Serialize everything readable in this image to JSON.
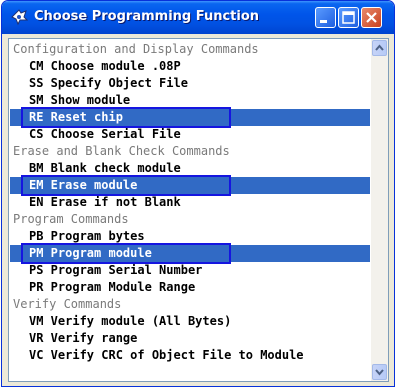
{
  "window": {
    "title": "Choose Programming Function"
  },
  "list": {
    "rows": [
      {
        "kind": "cat",
        "text": "Configuration and Display Commands",
        "selected": false
      },
      {
        "kind": "item",
        "text": "CM Choose module .08P",
        "selected": false
      },
      {
        "kind": "item",
        "text": "SS Specify Object File",
        "selected": false
      },
      {
        "kind": "item",
        "text": "SM Show module",
        "selected": false
      },
      {
        "kind": "item",
        "text": "RE Reset chip",
        "selected": true
      },
      {
        "kind": "item",
        "text": "CS Choose Serial File",
        "selected": false
      },
      {
        "kind": "cat",
        "text": "Erase and Blank Check Commands",
        "selected": false
      },
      {
        "kind": "item",
        "text": "BM Blank check module",
        "selected": false
      },
      {
        "kind": "item",
        "text": "EM Erase module",
        "selected": true
      },
      {
        "kind": "item",
        "text": "EN Erase if not Blank",
        "selected": false
      },
      {
        "kind": "cat",
        "text": "Program Commands",
        "selected": false
      },
      {
        "kind": "item",
        "text": "PB Program bytes",
        "selected": false
      },
      {
        "kind": "item",
        "text": "PM Program module",
        "selected": true
      },
      {
        "kind": "item",
        "text": "PS Program Serial Number",
        "selected": false
      },
      {
        "kind": "item",
        "text": "PR Program Module Range",
        "selected": false
      },
      {
        "kind": "cat",
        "text": "Verify Commands",
        "selected": false
      },
      {
        "kind": "item",
        "text": "VM Verify module (All Bytes)",
        "selected": false
      },
      {
        "kind": "item",
        "text": "VR Verify range",
        "selected": false
      },
      {
        "kind": "item",
        "text": "VC Verify CRC of Object File to Module",
        "selected": false
      }
    ]
  },
  "colors": {
    "selection": "#316AC5",
    "highlight_box": "#1515E0",
    "category_text": "#7a7a7a"
  },
  "icons": {
    "app": "app-icon",
    "minimize": "minimize-icon",
    "maximize": "maximize-icon",
    "close": "close-icon",
    "scroll_up": "scroll-up-arrow-icon",
    "scroll_down": "scroll-down-arrow-icon"
  }
}
